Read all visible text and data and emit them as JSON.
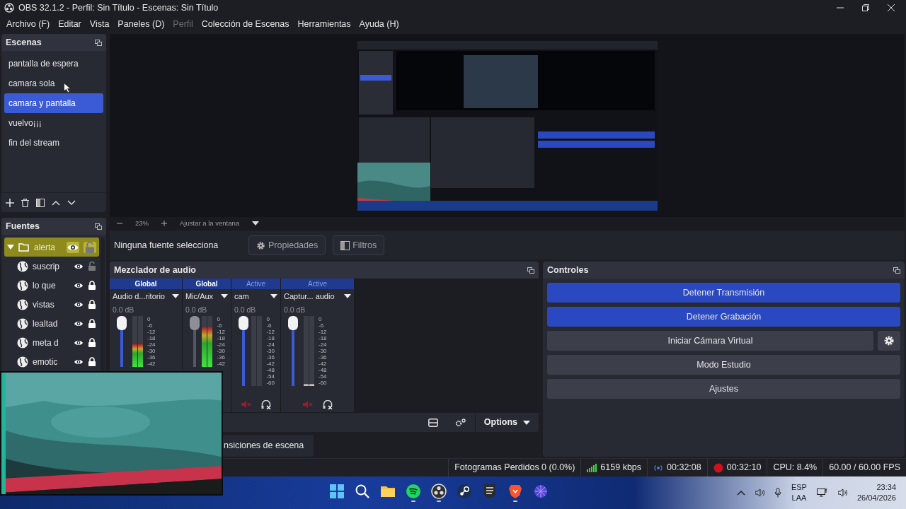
{
  "window": {
    "title": "OBS 32.1.2 - Perfil: Sin Título - Escenas: Sin Título"
  },
  "menu": [
    {
      "label": "Archivo (F)",
      "disabled": false
    },
    {
      "label": "Editar",
      "disabled": false
    },
    {
      "label": "Vista",
      "disabled": false
    },
    {
      "label": "Paneles (D)",
      "disabled": false
    },
    {
      "label": "Perfil",
      "disabled": true
    },
    {
      "label": "Colección de Escenas",
      "disabled": false
    },
    {
      "label": "Herramientas",
      "disabled": false
    },
    {
      "label": "Ayuda (H)",
      "disabled": false
    }
  ],
  "scenes": {
    "title": "Escenas",
    "items": [
      {
        "label": "pantalla de espera",
        "selected": false
      },
      {
        "label": "camara sola",
        "selected": false
      },
      {
        "label": "camara y pantalla",
        "selected": true
      },
      {
        "label": "vuelvo¡¡¡",
        "selected": false
      },
      {
        "label": "fin del stream",
        "selected": false
      }
    ]
  },
  "sources": {
    "title": "Fuentes",
    "items": [
      {
        "label": "alerta",
        "kind": "group",
        "selected": true,
        "expanded": true,
        "visible": true,
        "locked": false,
        "children": [
          {
            "label": "suscrip",
            "kind": "browser",
            "selected": false,
            "visible": true,
            "locked": false
          },
          {
            "label": "lo que ",
            "kind": "browser",
            "selected": false,
            "visible": true,
            "locked": true
          },
          {
            "label": "vistas",
            "kind": "browser",
            "selected": false,
            "visible": true,
            "locked": true
          },
          {
            "label": "lealtad",
            "kind": "browser",
            "selected": false,
            "visible": true,
            "locked": true
          },
          {
            "label": "meta d",
            "kind": "browser",
            "selected": false,
            "visible": true,
            "locked": true
          },
          {
            "label": "emotic",
            "kind": "browser",
            "selected": false,
            "visible": true,
            "locked": true
          }
        ]
      }
    ]
  },
  "preview": {
    "zoom": "23%",
    "fit": "Ajustar a la ventana"
  },
  "context_bar": {
    "status": "Ninguna fuente selecciona",
    "buttons": [
      "Propiedades",
      "Filtros"
    ]
  },
  "mixer": {
    "title": "Mezclador de audio",
    "options": "Options",
    "channels": [
      {
        "mode": "Global",
        "kind": "global",
        "name": "Audio d...ritorio",
        "volume": "0.0 dB",
        "fader": {
          "level": 1,
          "disabled": false
        },
        "meter": {
          "level": 0.45
        },
        "scale": [
          "0",
          "-6",
          "-12",
          "-18",
          "-24",
          "-30",
          "-36",
          "-42"
        ]
      },
      {
        "mode": "Global",
        "kind": "global",
        "name": "Mic/Aux",
        "volume": "0.0 dB",
        "fader": {
          "level": 1,
          "disabled": true
        },
        "meter": {
          "level": 0.78
        },
        "scale": [
          "0",
          "-6",
          "-12",
          "-18",
          "-24",
          "-30",
          "-36",
          "-42"
        ]
      },
      {
        "mode": "Active",
        "kind": "active",
        "name": "cam",
        "volume": "0.0 dB",
        "fader": {
          "level": 1,
          "disabled": false
        },
        "meter": {
          "level": 0.0
        },
        "muted": true,
        "scale": [
          "0",
          "-6",
          "-12",
          "-18",
          "-24",
          "-30",
          "-36",
          "-42",
          "-48",
          "-54",
          "-60"
        ]
      },
      {
        "mode": "Active",
        "kind": "active",
        "name": "Captur... audio",
        "volume": "0.0 dB",
        "fader": {
          "level": 1,
          "disabled": false
        },
        "meter": {
          "level": 0.03
        },
        "muted": true,
        "scale": [
          "0",
          "-6",
          "-12",
          "-18",
          "-24",
          "-30",
          "-36",
          "-42",
          "-48",
          "-54",
          "-60"
        ]
      }
    ]
  },
  "transitions_tab": "nsiciones de escena",
  "controls": {
    "title": "Controles",
    "buttons": [
      {
        "label": "Detener Transmisión",
        "active": true,
        "settings": false
      },
      {
        "label": "Detener Grabación",
        "active": true,
        "settings": false
      },
      {
        "label": "Iniciar Cámara Virtual",
        "active": false,
        "settings": true
      },
      {
        "label": "Modo Estudio",
        "active": false,
        "settings": false
      },
      {
        "label": "Ajustes",
        "active": false,
        "settings": false
      }
    ]
  },
  "status_bar": {
    "dropped": "Fotogramas Perdidos 0 (0.0%)",
    "bitrate": "6159 kbps",
    "stream_time": "00:32:08",
    "record_time": "00:32:10",
    "cpu": "CPU: 8.4%",
    "fps": "60.00 / 60.00 FPS"
  },
  "taskbar": {
    "apps": [
      {
        "kind": "start",
        "running": false
      },
      {
        "kind": "search",
        "running": false
      },
      {
        "kind": "folder",
        "running": false
      },
      {
        "kind": "music",
        "running": true
      },
      {
        "kind": "recorder",
        "running": true
      },
      {
        "kind": "steam",
        "running": false
      },
      {
        "kind": "shield",
        "running": false
      },
      {
        "kind": "lion",
        "running": true
      },
      {
        "kind": "web",
        "running": false
      }
    ],
    "language": "ESP",
    "layout": "LAA",
    "time": "23:34",
    "date": "26/04/2026"
  }
}
